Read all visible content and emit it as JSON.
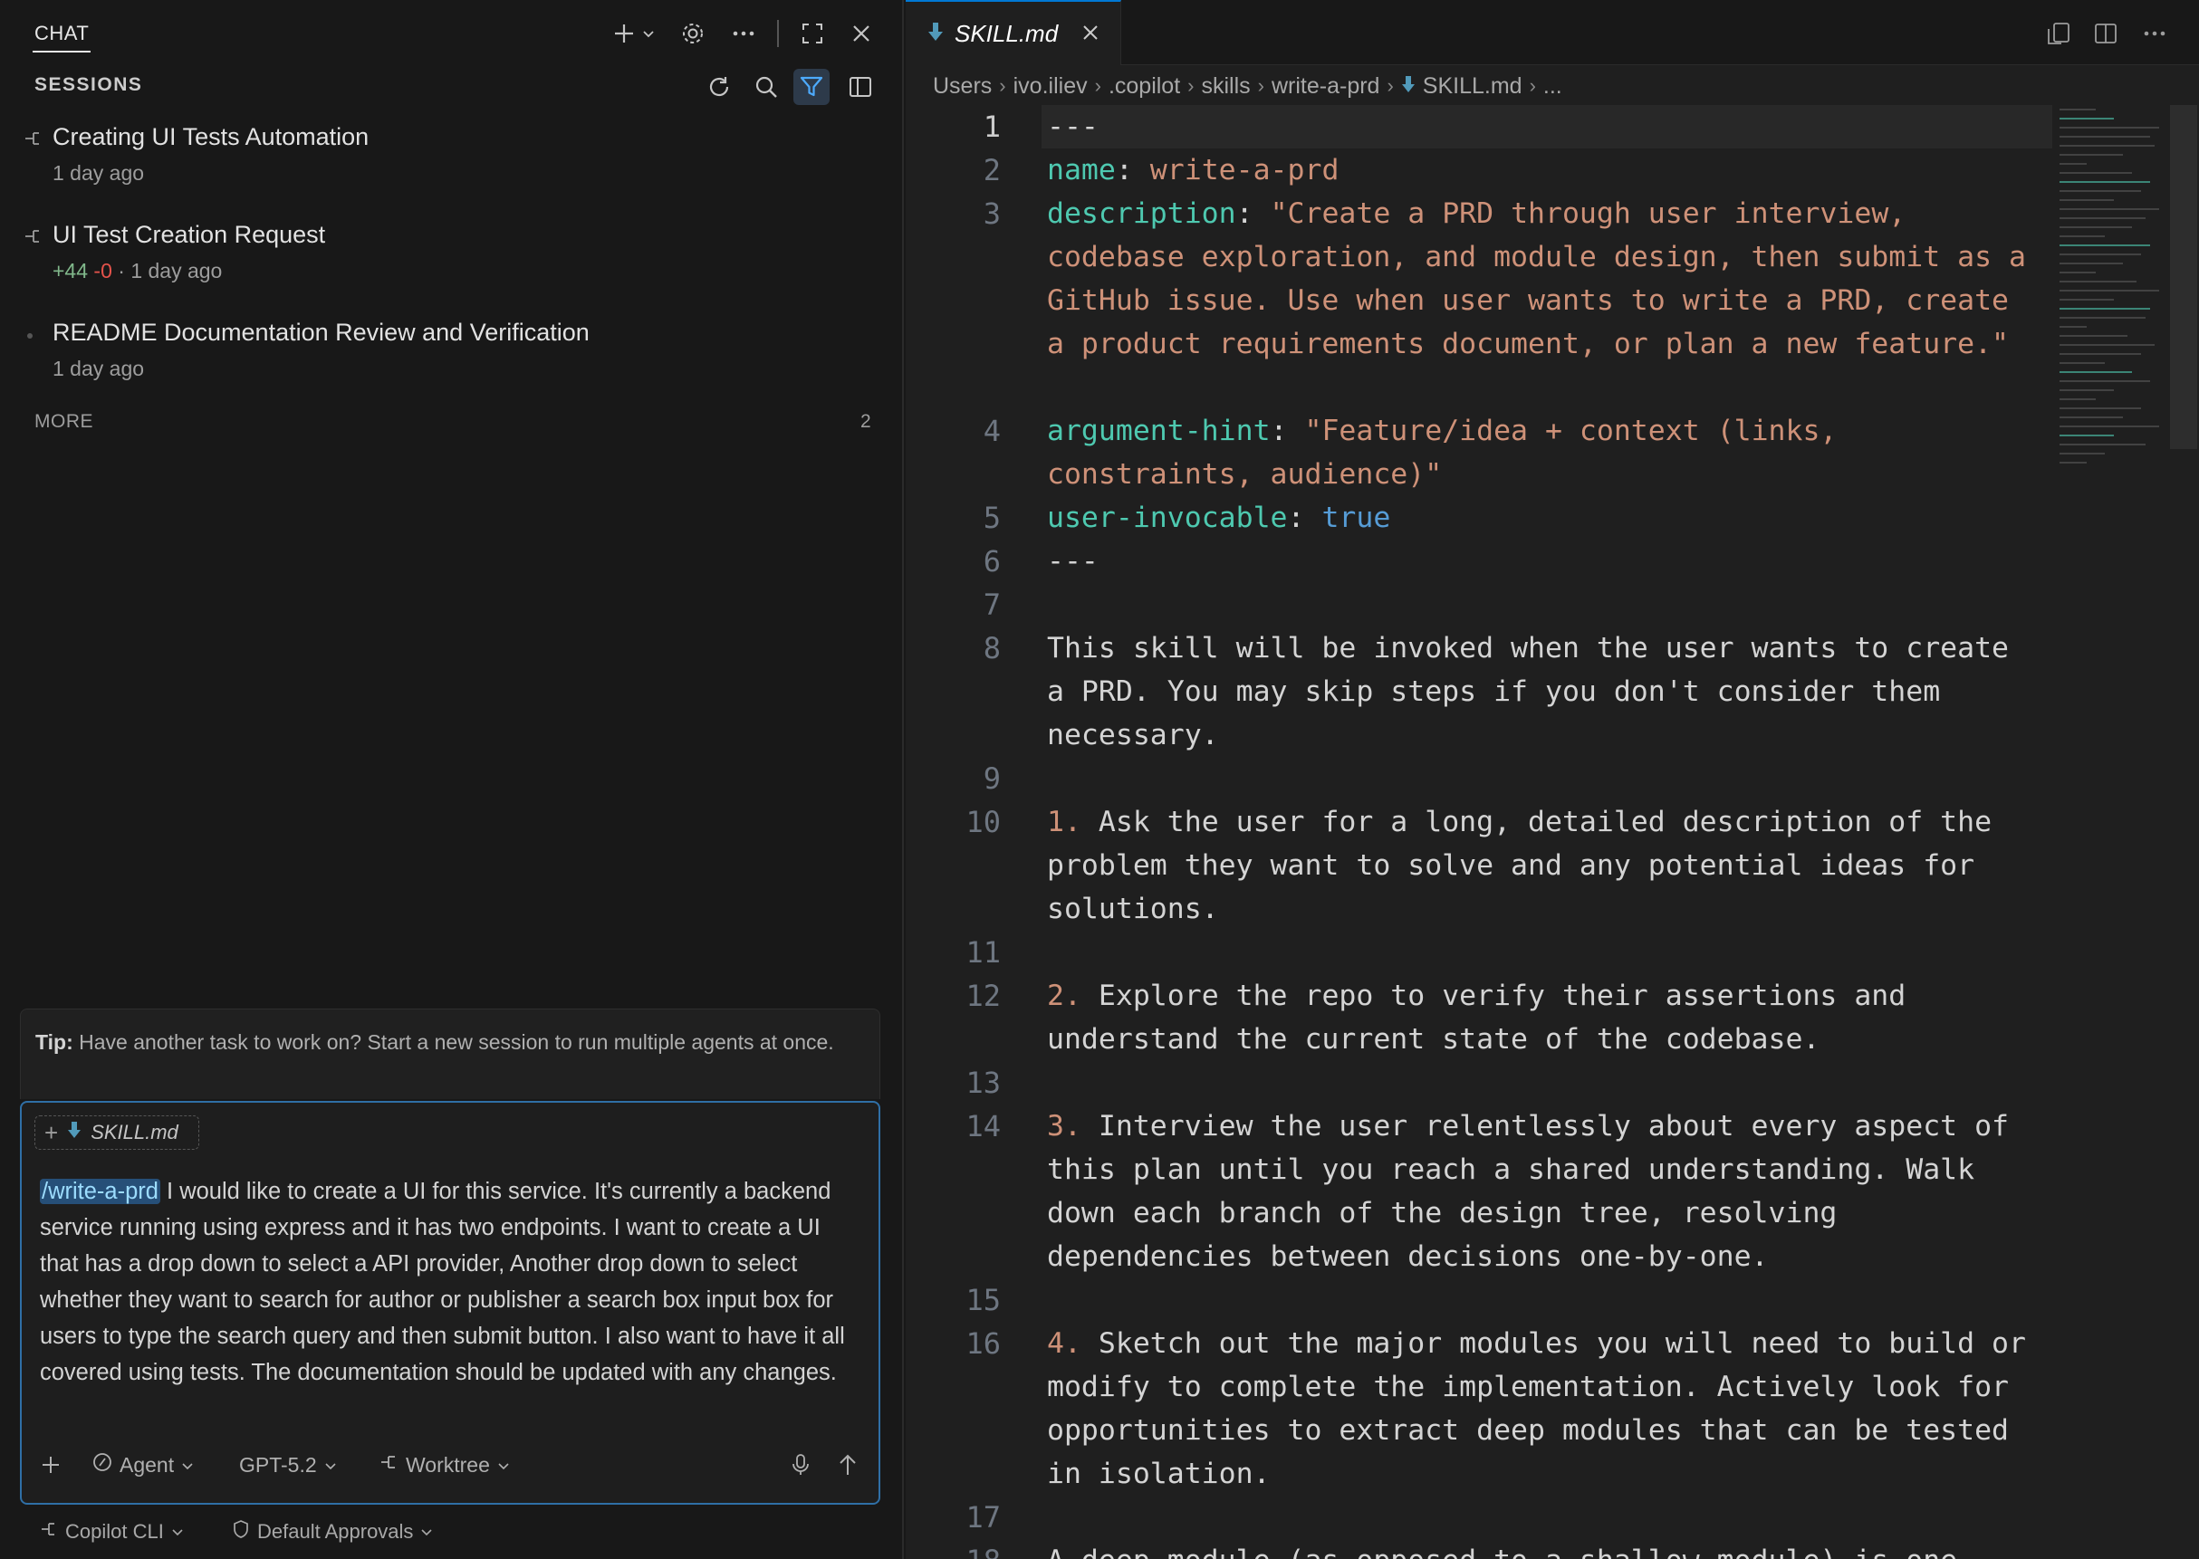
{
  "chat": {
    "title": "CHAT",
    "sessions_label": "SESSIONS",
    "sessions": [
      {
        "title": "Creating UI Tests Automation",
        "time": "1 day ago"
      },
      {
        "title": "UI Test Creation Request",
        "added": "+44",
        "removed": "-0",
        "sep": "·",
        "time": "1 day ago"
      },
      {
        "title": "README Documentation Review and Verification",
        "time": "1 day ago"
      }
    ],
    "more_label": "MORE",
    "more_count": "2",
    "tip_label": "Tip:",
    "tip_text": "Have another task to work on? Start a new session to run multiple agents at once.",
    "attachment": "SKILL.md",
    "prompt_command": "/write-a-prd",
    "prompt_text": " I would like to create a UI for this service. It's currently a backend service running using express and it has two endpoints. I want to create a UI that has a drop down to select a API provider, Another drop down to select whether they want to search for author or publisher a search box input box for users to type the search query and then submit button. I also want to have it all covered using tests. The documentation should be updated with any changes.",
    "mode": "Agent",
    "model": "GPT-5.2",
    "workspace": "Worktree",
    "footer_cli": "Copilot CLI",
    "footer_approvals": "Default Approvals"
  },
  "editor": {
    "tab_label": "SKILL.md",
    "breadcrumb": [
      "Users",
      "ivo.iliev",
      ".copilot",
      "skills",
      "write-a-prd",
      "SKILL.md",
      "..."
    ],
    "lines": [
      {
        "n": "1",
        "t": "---"
      },
      {
        "n": "2",
        "k": "name",
        "v": "write-a-prd"
      },
      {
        "n": "3",
        "k": "description",
        "v": "\"Create a PRD through user interview, codebase exploration, and module design, then submit as a GitHub issue. Use when user wants to write a PRD, create a product requirements document, or plan a new feature.\""
      },
      {
        "n": "4",
        "k": "argument-hint",
        "v": "\"Feature/idea + context (links, constraints, audience)\""
      },
      {
        "n": "5",
        "k": "user-invocable",
        "b": "true"
      },
      {
        "n": "6",
        "t": "---"
      },
      {
        "n": "7",
        "t": ""
      },
      {
        "n": "8",
        "t": "This skill will be invoked when the user wants to create a PRD. You may skip steps if you don't consider them necessary."
      },
      {
        "n": "9",
        "t": ""
      },
      {
        "n": "10",
        "m": "1.",
        "t": " Ask the user for a long, detailed description of the problem they want to solve and any potential ideas for solutions."
      },
      {
        "n": "11",
        "t": ""
      },
      {
        "n": "12",
        "m": "2.",
        "t": " Explore the repo to verify their assertions and understand the current state of the codebase."
      },
      {
        "n": "13",
        "t": ""
      },
      {
        "n": "14",
        "m": "3.",
        "t": " Interview the user relentlessly about every aspect of this plan until you reach a shared understanding. Walk down each branch of the design tree, resolving dependencies between decisions one-by-one."
      },
      {
        "n": "15",
        "t": ""
      },
      {
        "n": "16",
        "m": "4.",
        "t": " Sketch out the major modules you will need to build or modify to complete the implementation. Actively look for opportunities to extract deep modules that can be tested in isolation."
      },
      {
        "n": "17",
        "t": ""
      },
      {
        "n": "18",
        "t": "A deep module (as opposed to a shallow module) is one"
      }
    ]
  },
  "colors": {
    "accent": "#0078d4",
    "yaml_key": "#4ec9b0",
    "string": "#ce9178",
    "boolean": "#569cd6",
    "list_marker": "#ce9178",
    "diff_added": "#81b88b",
    "diff_removed": "#e5534b"
  },
  "icons": [
    "plus-icon",
    "chevron-down-icon",
    "gear-icon",
    "ellipsis-icon",
    "maximize-icon",
    "close-icon",
    "refresh-icon",
    "search-icon",
    "filter-icon",
    "split-panel-icon",
    "session-icon",
    "markdown-icon",
    "tools-icon",
    "microphone-icon",
    "send-arrow-icon",
    "shield-icon",
    "split-editor-icon",
    "open-changes-icon"
  ]
}
